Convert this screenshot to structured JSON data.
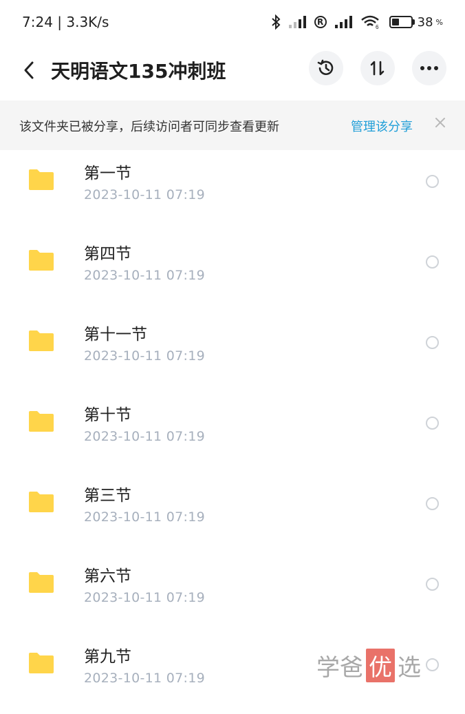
{
  "status_bar": {
    "time_speed": "7:24 | 3.3K/s",
    "wifi_badge": "6",
    "battery_percent": "38",
    "battery_symbol": "%"
  },
  "header": {
    "title": "天明语文135冲刺班",
    "back_icon": "chevron-left-icon",
    "history_icon": "history-icon",
    "sort_icon": "sort-icon",
    "more_icon": "more-horizontal-icon"
  },
  "banner": {
    "text": "该文件夹已被分享，后续访问者可同步查看更新",
    "link": "管理该分享"
  },
  "files": [
    {
      "name": "第一节",
      "date": "2023-10-11  07:19"
    },
    {
      "name": "第四节",
      "date": "2023-10-11  07:19"
    },
    {
      "name": "第十一节",
      "date": "2023-10-11  07:19"
    },
    {
      "name": "第十节",
      "date": "2023-10-11  07:19"
    },
    {
      "name": "第三节",
      "date": "2023-10-11  07:19"
    },
    {
      "name": "第六节",
      "date": "2023-10-11  07:19"
    },
    {
      "name": "第九节",
      "date": "2023-10-11  07:19"
    }
  ],
  "watermark": {
    "part1": "学爸",
    "part2": "优",
    "part3": "选"
  },
  "colors": {
    "folder": "#ffd54a",
    "link": "#1f9ed8",
    "date": "#a7b0bd",
    "banner_bg": "#f5f5f5"
  }
}
